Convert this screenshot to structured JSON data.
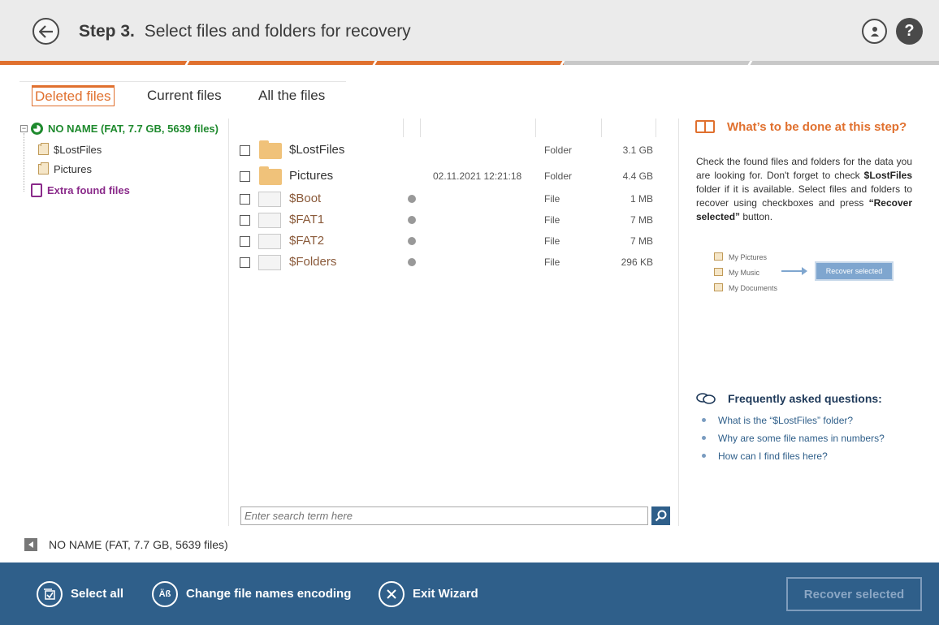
{
  "header": {
    "step_label": "Step 3.",
    "title": "Select files and folders for recovery"
  },
  "progress": {
    "completed_fraction": 0.6
  },
  "tabs": [
    {
      "label": "Deleted files",
      "active": true
    },
    {
      "label": "Current files",
      "active": false
    },
    {
      "label": "All the files",
      "active": false
    }
  ],
  "tree": {
    "root": {
      "label": "NO NAME (FAT, 7.7 GB, 5639 files)",
      "expander": "−"
    },
    "children": [
      {
        "label": "$LostFiles"
      },
      {
        "label": "Pictures"
      }
    ],
    "extra": {
      "label": "Extra found files"
    }
  },
  "files": [
    {
      "name": "$LostFiles",
      "kind": "folder",
      "date": "",
      "type": "Folder",
      "size": "3.1 GB",
      "deleted": false
    },
    {
      "name": "Pictures",
      "kind": "folder",
      "date": "02.11.2021 12:21:18",
      "type": "Folder",
      "size": "4.4 GB",
      "deleted": false
    },
    {
      "name": "$Boot",
      "kind": "file",
      "date": "",
      "type": "File",
      "size": "1 MB",
      "deleted": true
    },
    {
      "name": "$FAT1",
      "kind": "file",
      "date": "",
      "type": "File",
      "size": "7 MB",
      "deleted": true
    },
    {
      "name": "$FAT2",
      "kind": "file",
      "date": "",
      "type": "File",
      "size": "7 MB",
      "deleted": true
    },
    {
      "name": "$Folders",
      "kind": "file",
      "date": "",
      "type": "File",
      "size": "296 KB",
      "deleted": true
    }
  ],
  "search": {
    "placeholder": "Enter search term here"
  },
  "status": {
    "text": "NO NAME (FAT, 7.7 GB, 5639 files)"
  },
  "help": {
    "title": "What’s to be done at this step?",
    "text_1": "Check the found files and folders for the data you are looking for. Don't forget to check ",
    "text_bold_1": "$LostFiles",
    "text_2": " folder if it is available. Select files and folders to recover using checkboxes and press ",
    "text_bold_2": "“Recover selected”",
    "text_3": " button.",
    "illustration": {
      "items": [
        "My Pictures",
        "My Music",
        "My Documents"
      ],
      "button": "Recover selected"
    }
  },
  "faq": {
    "title": "Frequently asked questions:",
    "items": [
      "What is the “$LostFiles” folder?",
      "Why are some file names in numbers?",
      "How can I find files here?"
    ]
  },
  "footer": {
    "select_all": "Select all",
    "change_encoding": "Change file names encoding",
    "encoding_glyph": "Äß",
    "exit_wizard": "Exit Wizard",
    "recover_selected": "Recover selected"
  },
  "colors": {
    "accent": "#e0702e",
    "footer_bg": "#2f5f8a",
    "root_green": "#1f8a2e",
    "extra_purple": "#8a2a8a"
  }
}
